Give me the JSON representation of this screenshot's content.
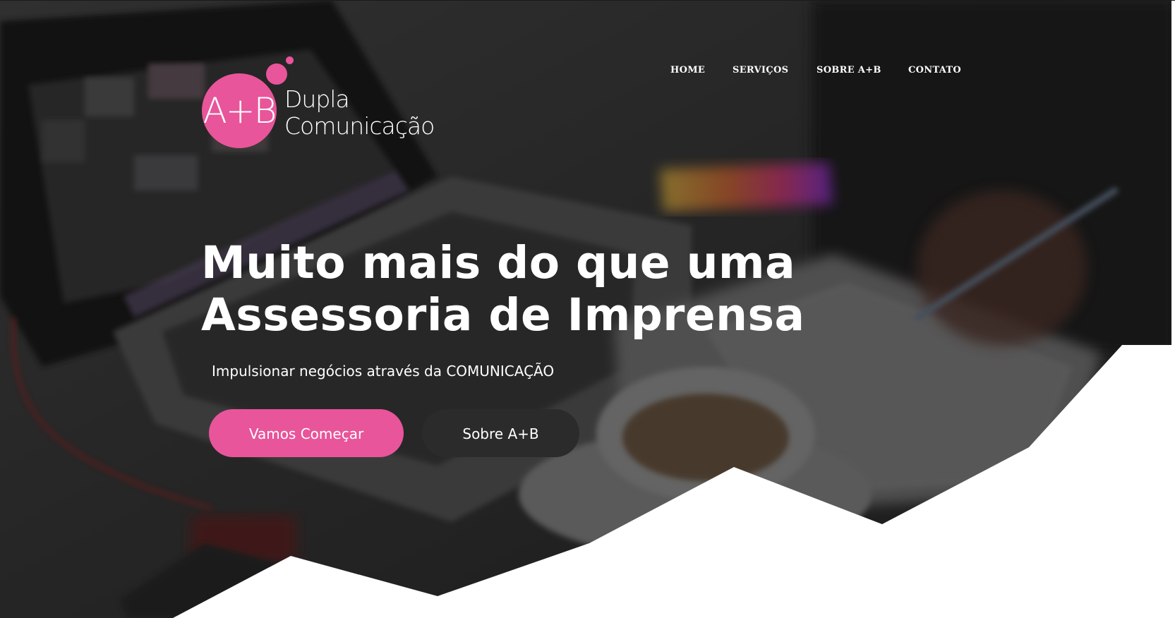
{
  "brand": {
    "logo_mark": "A+B",
    "logo_line1": "Dupla",
    "logo_line2": "Comunicação",
    "accent_color": "#e8559a",
    "dark_color": "#2b2b2b"
  },
  "nav": {
    "items": [
      {
        "label": "HOME"
      },
      {
        "label": "SERVIÇOS"
      },
      {
        "label": "SOBRE A+B"
      },
      {
        "label": "CONTATO"
      }
    ]
  },
  "hero": {
    "headline_line1": "Muito mais do que uma",
    "headline_line2": "Assessoria de Imprensa",
    "subline": "Impulsionar negócios através da COMUNICAÇÃO",
    "primary_button": "Vamos Começar",
    "secondary_button": "Sobre A+B",
    "background_photo": "laptop-desk-coffee-photo"
  }
}
